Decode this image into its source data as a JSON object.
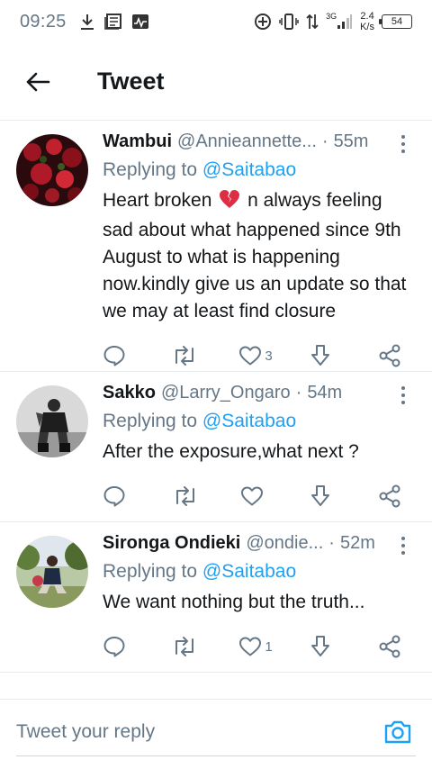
{
  "status_bar": {
    "time": "09:25",
    "network_type": "3G",
    "net_speed_value": "2.4",
    "net_speed_unit": "K/s",
    "battery": "54"
  },
  "header": {
    "title": "Tweet"
  },
  "tweets": [
    {
      "name": "Wambui",
      "handle": "@Annieannette...",
      "separator": "·",
      "time": "55m",
      "replying_prefix": "Replying to",
      "replying_to": "@Saitabao",
      "text_before": "Heart broken",
      "text_after": "n always feeling sad about what happened since 9th August to what is happening now.kindly give us an update so that we may at least find closure",
      "like_count": "3"
    },
    {
      "name": "Sakko",
      "handle": "@Larry_Ongaro",
      "separator": "·",
      "time": "54m",
      "replying_prefix": "Replying to",
      "replying_to": "@Saitabao",
      "text": "After the exposure,what next ?",
      "like_count": ""
    },
    {
      "name": "Sironga Ondieki",
      "handle": "@ondie...",
      "separator": "·",
      "time": "52m",
      "replying_prefix": "Replying to",
      "replying_to": "@Saitabao",
      "text": "We want nothing but the truth...",
      "like_count": "1"
    }
  ],
  "reply_bar": {
    "placeholder": "Tweet your reply"
  },
  "colors": {
    "accent": "#1da1f2",
    "secondary_text": "#657786",
    "divider": "#e6ecf0"
  },
  "icons": {
    "back": "arrow-left-icon",
    "reply": "speech-bubble-icon",
    "retweet": "retweet-icon",
    "like": "heart-icon",
    "share_down": "download-arrow-icon",
    "share": "share-icon",
    "camera": "camera-icon"
  }
}
